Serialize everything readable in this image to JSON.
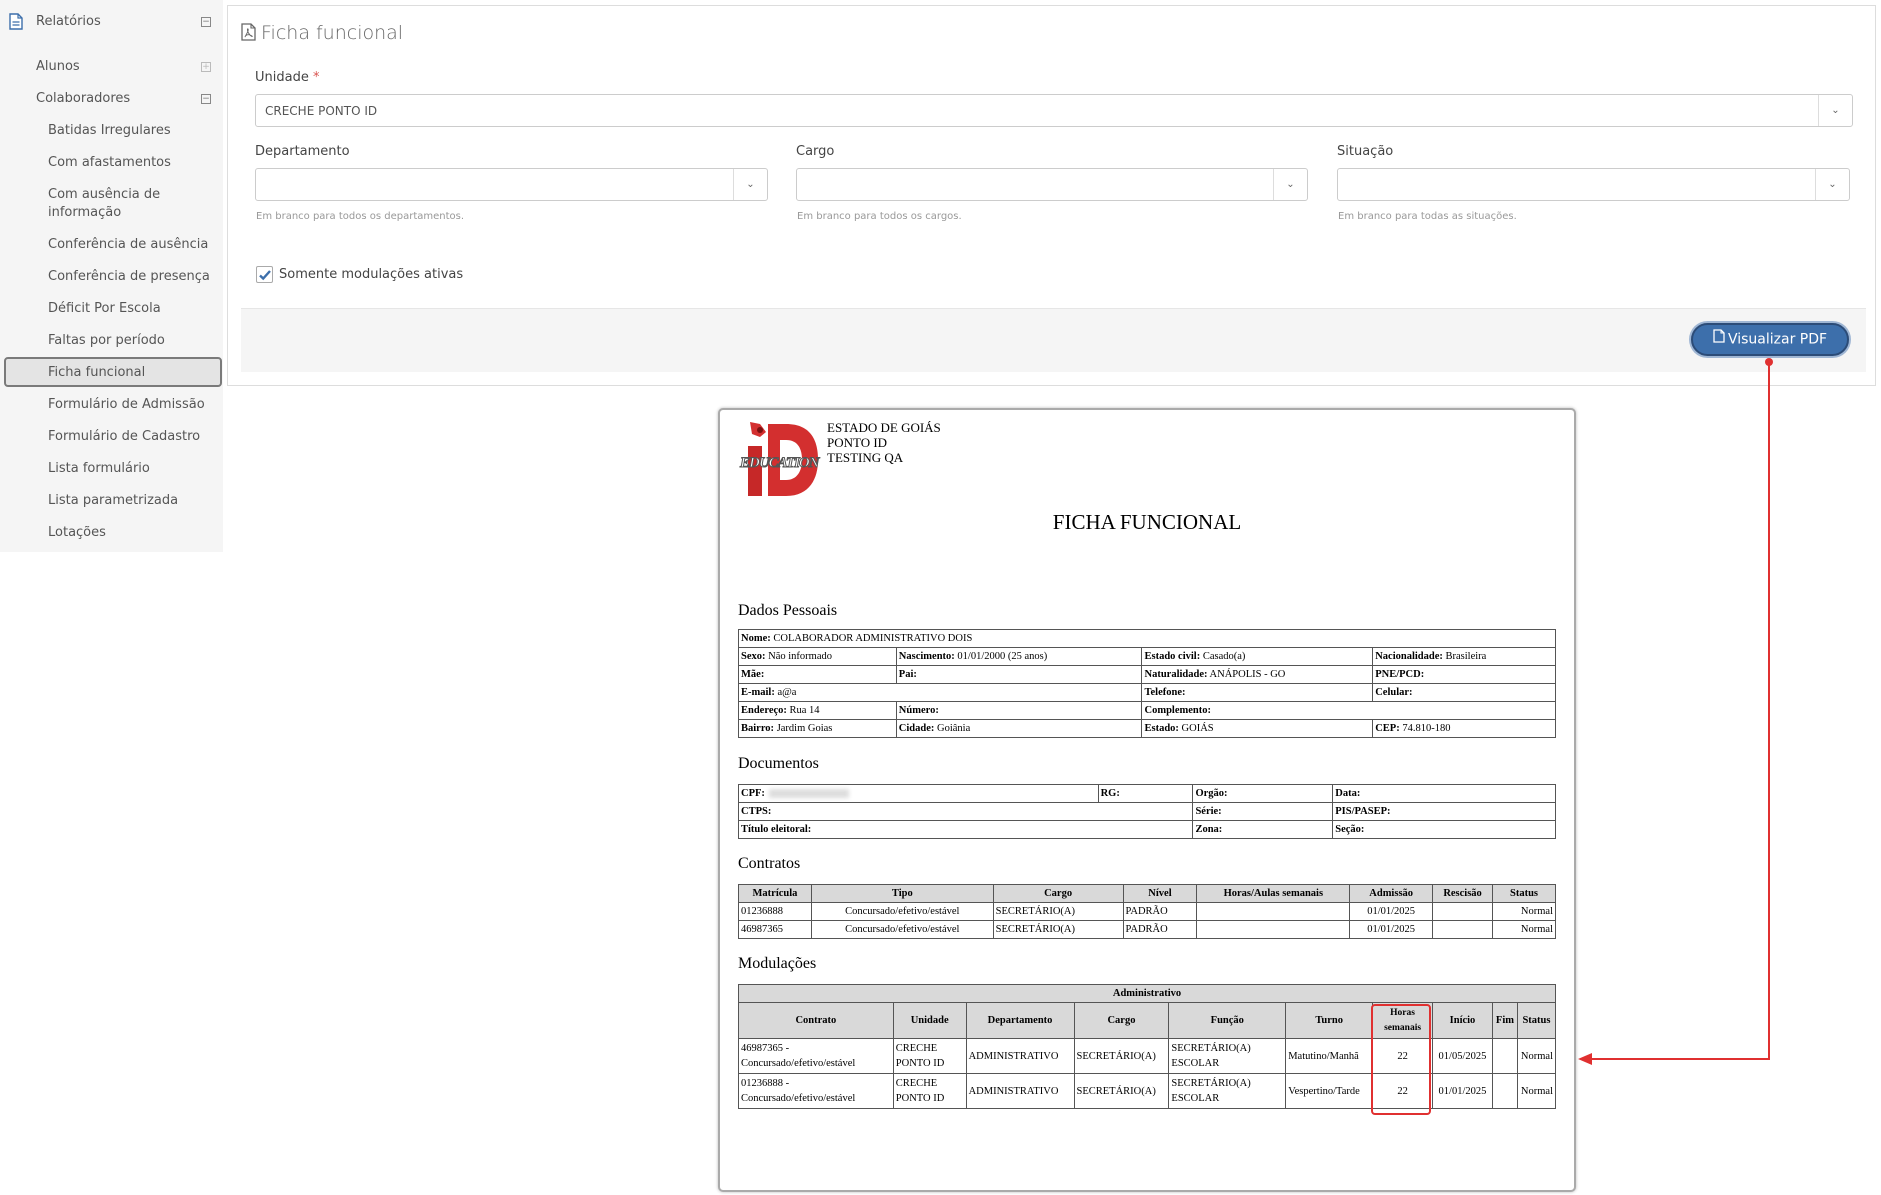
{
  "sidebar": {
    "reports": "Relatórios",
    "students": "Alunos",
    "collaborators": "Colaboradores",
    "items": [
      "Batidas Irregulares",
      "Com afastamentos",
      "Com ausência de informação",
      "Conferência de ausência",
      "Conferência de presença",
      "Déficit Por Escola",
      "Faltas por período",
      "Ficha funcional",
      "Formulário de Admissão",
      "Formulário de Cadastro",
      "Lista formulário",
      "Lista parametrizada",
      "Lotações"
    ],
    "active_item": "Ficha funcional"
  },
  "panel": {
    "title": "Ficha funcional",
    "unit_label": "Unidade",
    "required_mark": "*",
    "unit_value": "CRECHE PONTO ID",
    "department_label": "Departamento",
    "department_help": "Em branco para todos os departamentos.",
    "role_label": "Cargo",
    "role_help": "Em branco para todos os cargos.",
    "status_label": "Situação",
    "status_help": "Em branco para todas as situações.",
    "checkbox_label": "Somente modulações ativas",
    "checkbox_checked": true,
    "pdf_button": "Visualizar PDF"
  },
  "document": {
    "logo_text": "EDUCATION",
    "header_lines": [
      "ESTADO DE GOIÁS",
      "PONTO ID",
      "TESTING QA"
    ],
    "title": "FICHA FUNCIONAL",
    "personal": {
      "section": "Dados Pessoais",
      "nome_l": "Nome:",
      "nome_v": "COLABORADOR ADMINISTRATIVO DOIS",
      "sexo_l": "Sexo:",
      "sexo_v": "Não informado",
      "nasc_l": "Nascimento:",
      "nasc_v": "01/01/2000 (25 anos)",
      "civil_l": "Estado civil:",
      "civil_v": "Casado(a)",
      "nac_l": "Nacionalidade:",
      "nac_v": "Brasileira",
      "mae_l": "Mãe:",
      "pai_l": "Pai:",
      "nat_l": "Naturalidade:",
      "nat_v": "ANÁPOLIS - GO",
      "pne_l": "PNE/PCD:",
      "email_l": "E-mail:",
      "email_v": "a@a",
      "tel_l": "Telefone:",
      "cel_l": "Celular:",
      "end_l": "Endereço:",
      "end_v": "Rua 14",
      "num_l": "Número:",
      "comp_l": "Complemento:",
      "bairro_l": "Bairro:",
      "bairro_v": "Jardim Goias",
      "cid_l": "Cidade:",
      "cid_v": "Goiânia",
      "est_l": "Estado:",
      "est_v": "GOIÁS",
      "cep_l": "CEP:",
      "cep_v": "74.810-180"
    },
    "documents": {
      "section": "Documentos",
      "cpf_l": "CPF:",
      "rg_l": "RG:",
      "orgao_l": "Orgão:",
      "data_l": "Data:",
      "ctps_l": "CTPS:",
      "serie_l": "Série:",
      "pis_l": "PIS/PASEP:",
      "titulo_l": "Título eleitoral:",
      "zona_l": "Zona:",
      "secao_l": "Seção:"
    },
    "contracts": {
      "section": "Contratos",
      "headers": [
        "Matrícula",
        "Tipo",
        "Cargo",
        "Nível",
        "Horas/Aulas semanais",
        "Admissão",
        "Rescisão",
        "Status"
      ],
      "rows": [
        [
          "01236888",
          "Concursado/efetivo/estável",
          "SECRETÁRIO(A)",
          "PADRÃO",
          "",
          "01/01/2025",
          "",
          "Normal"
        ],
        [
          "46987365",
          "Concursado/efetivo/estável",
          "SECRETÁRIO(A)",
          "PADRÃO",
          "",
          "01/01/2025",
          "",
          "Normal"
        ]
      ]
    },
    "modulations": {
      "section": "Modulações",
      "group": "Administrativo",
      "headers": [
        "Contrato",
        "Unidade",
        "Departamento",
        "Cargo",
        "Função",
        "Turno",
        "Horas semanais",
        "Início",
        "Fim",
        "Status"
      ],
      "rows": [
        [
          "46987365 - Concursado/efetivo/estável",
          "CRECHE PONTO ID",
          "ADMINISTRATIVO",
          "SECRETÁRIO(A)",
          "SECRETÁRIO(A) ESCOLAR",
          "Matutino/Manhã",
          "22",
          "01/05/2025",
          "",
          "Normal"
        ],
        [
          "01236888 - Concursado/efetivo/estável",
          "CRECHE PONTO ID",
          "ADMINISTRATIVO",
          "SECRETÁRIO(A)",
          "SECRETÁRIO(A) ESCOLAR",
          "Vespertino/Tarde",
          "22",
          "01/01/2025",
          "",
          "Normal"
        ]
      ]
    }
  },
  "colors": {
    "accent_blue": "#3d6fab",
    "highlight_red": "#e03030",
    "sidebar_bg": "#f5f5f5"
  }
}
